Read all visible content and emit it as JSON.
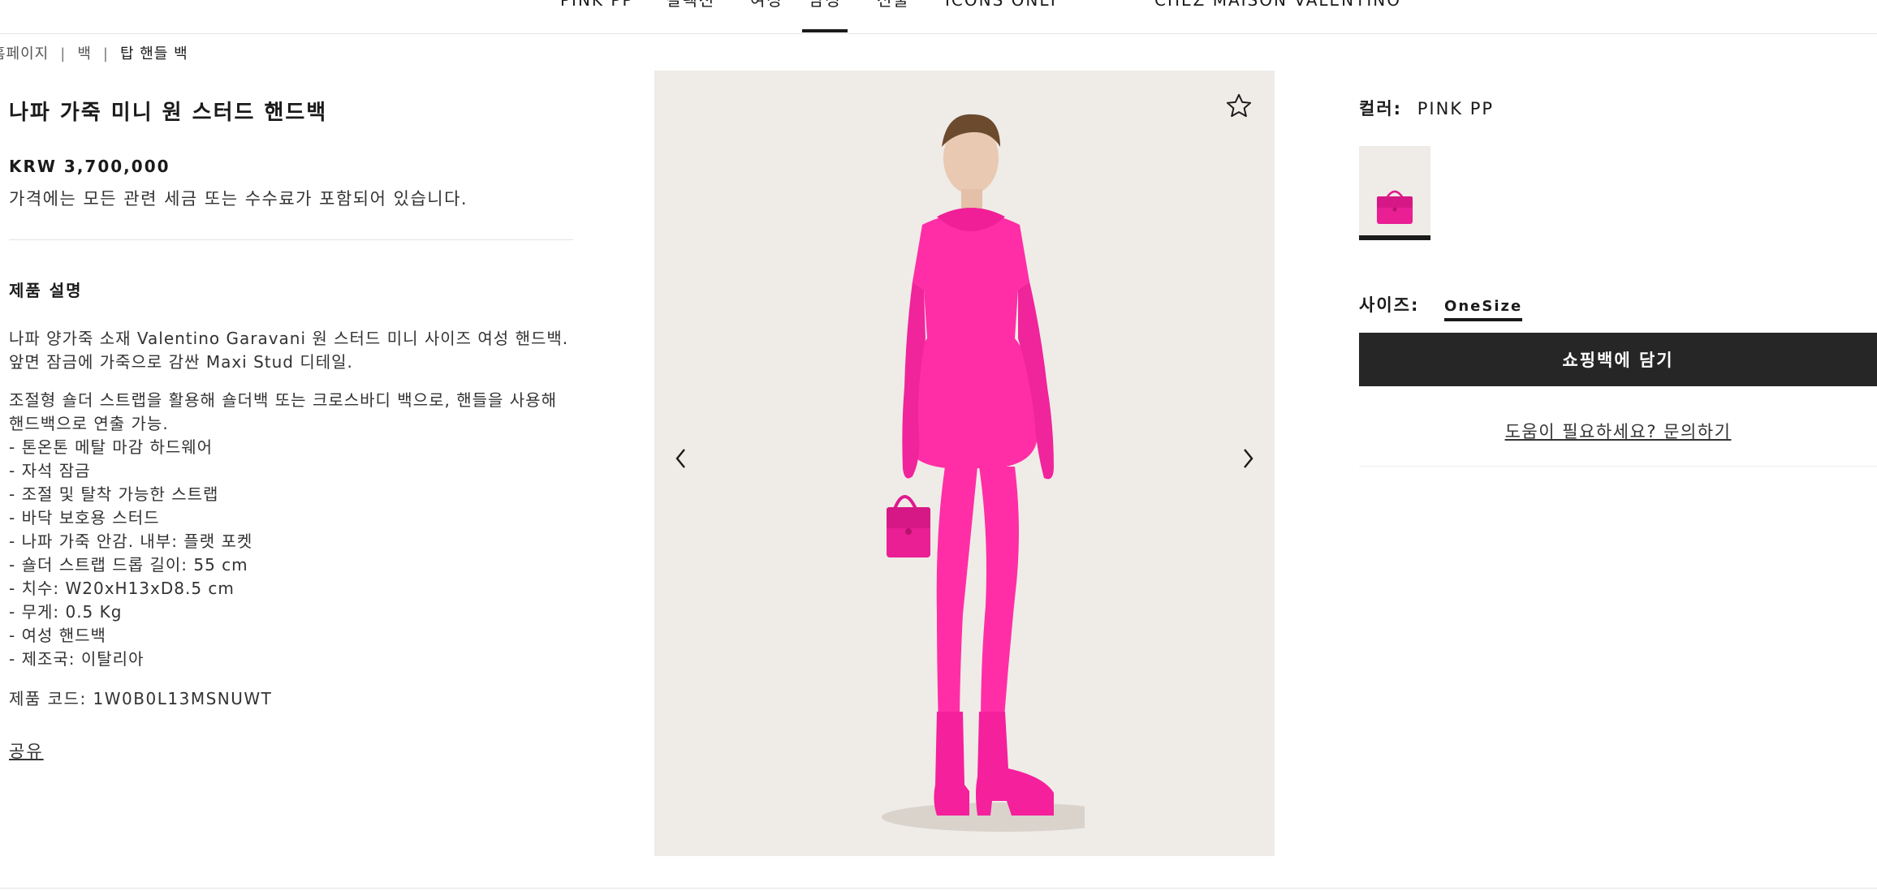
{
  "nav": {
    "items": [
      {
        "label": "PINK PP"
      },
      {
        "label": "컬렉션"
      },
      {
        "label": "여성"
      },
      {
        "label": "남성"
      },
      {
        "label": "선물"
      },
      {
        "label": "ICONS ONLY"
      },
      {
        "label": "CHEZ MAISON VALENTINO"
      }
    ]
  },
  "breadcrumb": {
    "home": "홈페이지",
    "bags": "백",
    "current": "탑 핸들 백",
    "separator": "|"
  },
  "product": {
    "title": "나파 가죽 미니 원 스터드 핸드백",
    "price": "KRW 3,700,000",
    "tax_note": "가격에는 모든 관련 세금 또는 수수료가 포함되어 있습니다.",
    "description_heading": "제품 설명",
    "description_p1": "나파 양가죽 소재 Valentino Garavani 원 스터드 미니 사이즈 여성 핸드백. 앞면 잠금에 가죽으로 감싼 Maxi Stud 디테일.",
    "description_p2": "조절형 숄더 스트랩을 활용해 숄더백 또는 크로스바디 백으로, 핸들을 사용해 핸드백으로 연출 가능.",
    "features": [
      "- 톤온톤 메탈 마감 하드웨어",
      "- 자석 잠금",
      "- 조절 및 탈착 가능한 스트랩",
      "- 바닥 보호용 스터드",
      "- 나파 가죽 안감. 내부: 플랫 포켓",
      "- 숄더 스트랩 드롭 길이: 55 cm",
      "- 치수: W20xH13xD8.5 cm",
      "- 무게: 0.5 Kg",
      "- 여성 핸드백",
      "- 제조국: 이탈리아"
    ],
    "code": "제품 코드: 1W0B0L13MSNUWT",
    "share": "공유"
  },
  "options": {
    "color_label": "컬러:",
    "color_value": "PINK PP",
    "size_label": "사이즈:",
    "size_value": "OneSize",
    "add_to_bag": "쇼핑백에 담기",
    "help": "도움이 필요하세요? 문의하기"
  },
  "colors": {
    "accent": "#ff2ea6",
    "gallery_bg": "#efebe7",
    "button_bg": "#262626"
  },
  "icons": {
    "favorite": "star-outline-icon",
    "prev": "chevron-left-icon",
    "next": "chevron-right-icon"
  }
}
